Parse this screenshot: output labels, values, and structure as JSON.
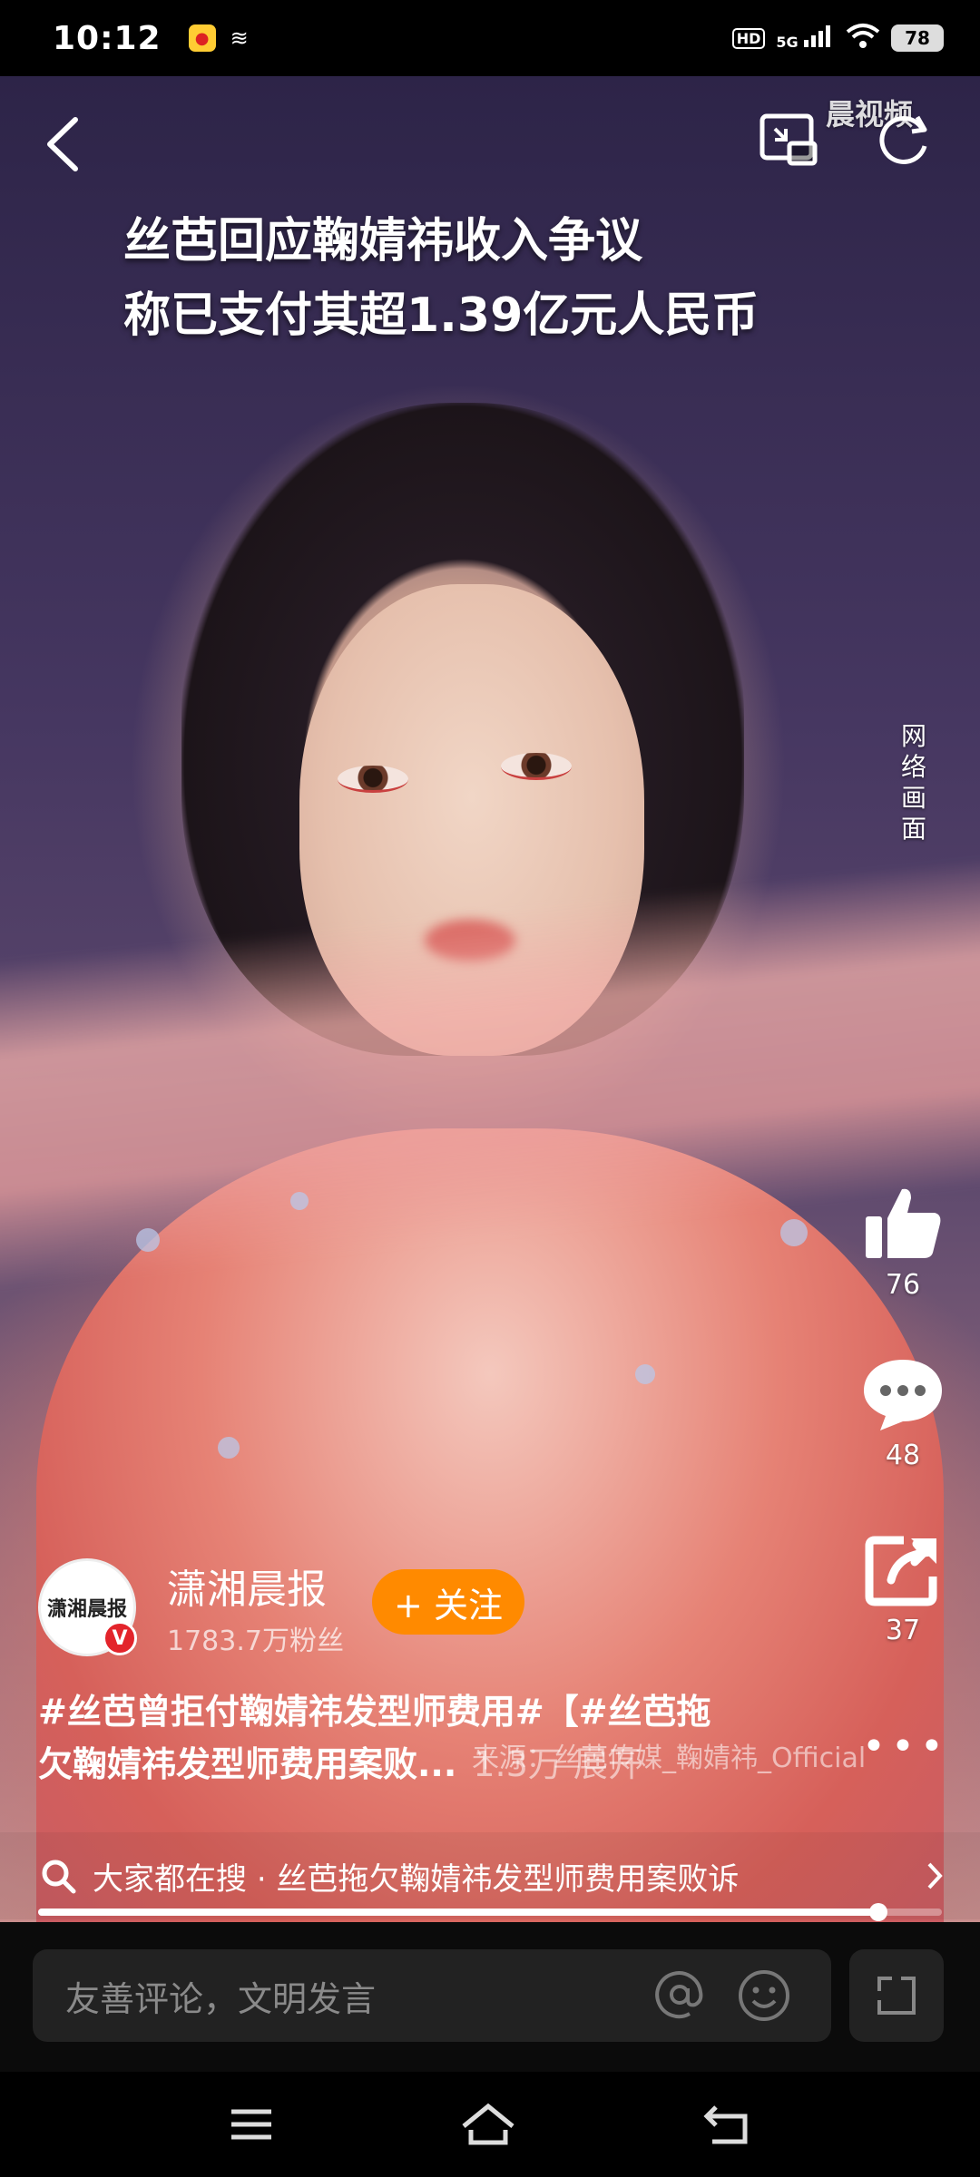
{
  "status_bar": {
    "time": "10:12",
    "hd_label": "HD",
    "signal_label": "5G",
    "battery": "78"
  },
  "video": {
    "headline_line1": "丝芭回应鞠婧祎收入争议",
    "headline_line2": "称已支付其超1.39亿元人民币",
    "watermark": "晨视频",
    "side_note": "网络画面"
  },
  "rail": {
    "likes": "76",
    "comments": "48",
    "shares": "37"
  },
  "author": {
    "avatar_text": "潇湘晨报",
    "name": "潇湘晨报",
    "fans": "1783.7万粉丝",
    "follow_label": "+ 关注",
    "verified_badge": "V"
  },
  "caption": {
    "line1": "#丝芭曾拒付鞠婧祎发型师费用#【#丝芭拖",
    "line2": "欠鞠婧祎发型师费用案败...",
    "views": "1.3万 展开",
    "source": "来源：丝芭传媒_鞠婧祎_Official"
  },
  "search": {
    "prefix": "大家都在搜",
    "separator": "·",
    "query": "丝芭拖欠鞠婧祎发型师费用案败诉"
  },
  "progress": {
    "value": 0.93
  },
  "comment_bar": {
    "placeholder": "友善评论，文明发言"
  },
  "icons": {
    "back": "chevron-left-icon",
    "pip": "picture-in-picture-icon",
    "refresh": "refresh-icon",
    "like": "thumbs-up-icon",
    "comment": "comment-bubble-icon",
    "share": "share-icon",
    "search": "search-icon",
    "at": "at-sign-icon",
    "emoji": "emoji-icon",
    "expand": "expand-icon"
  },
  "colors": {
    "follow": "#ff8a00",
    "verified": "#e3242b"
  }
}
